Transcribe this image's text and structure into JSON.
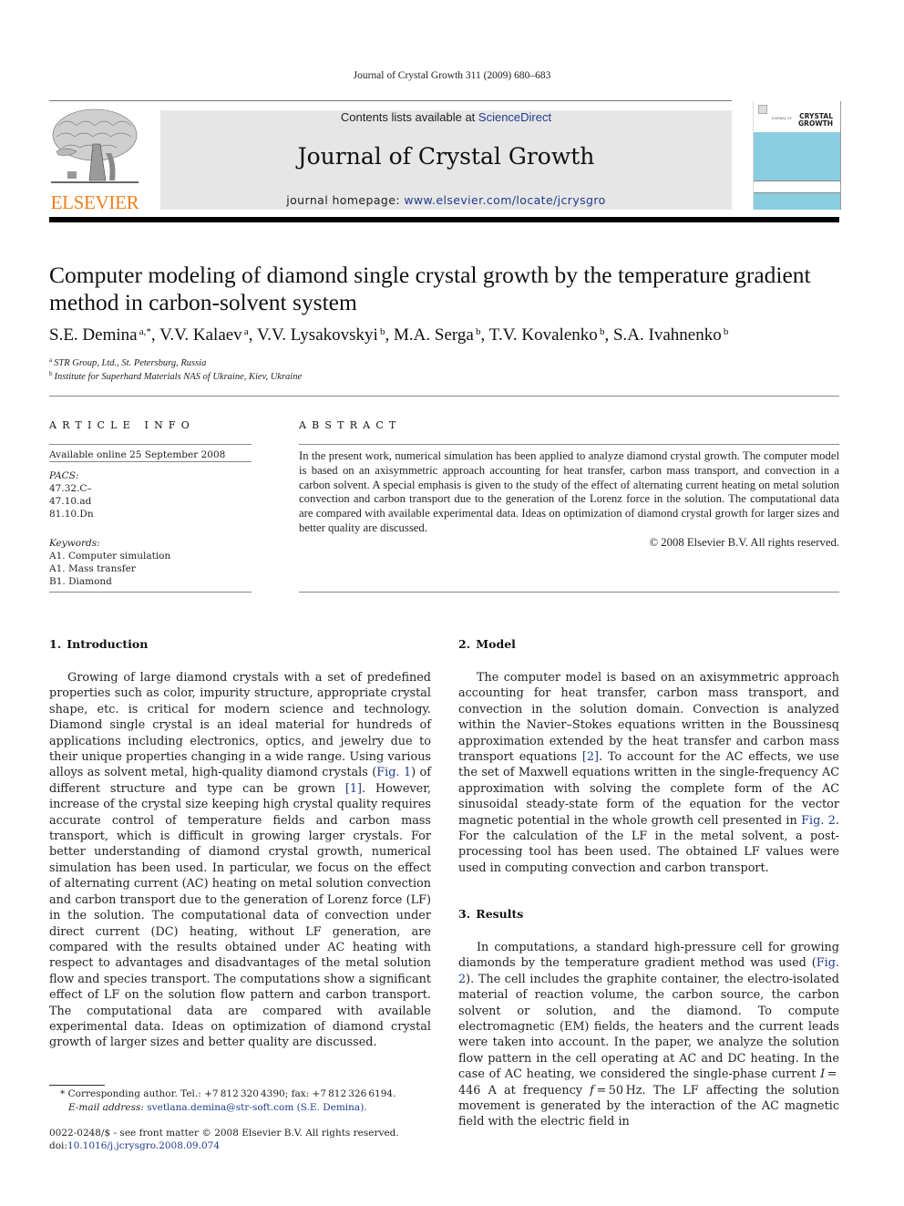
{
  "running_header": "Journal of Crystal Growth 311 (2009) 680–683",
  "banner": {
    "contents_prefix": "Contents lists available at ",
    "contents_link": "ScienceDirect",
    "journal_title": "Journal of Crystal Growth",
    "homepage_prefix": "journal homepage: ",
    "homepage_link": "www.elsevier.com/locate/jcrysgro"
  },
  "publisher_logo": {
    "wordmark": "ELSEVIER",
    "color": "#f07e1c"
  },
  "cover": {
    "small_text": "JOURNAL OF",
    "title_line1": "CRYSTAL",
    "title_line2": "GROWTH",
    "accent": "#8bcde0"
  },
  "article": {
    "title": "Computer modeling of diamond single crystal growth by the temperature gradient method in carbon-solvent system",
    "authors": [
      {
        "name": "S.E. Demina",
        "sup": "a,*"
      },
      {
        "name": "V.V. Kalaev",
        "sup": "a"
      },
      {
        "name": "V.V. Lysakovskyi",
        "sup": "b"
      },
      {
        "name": "M.A. Serga",
        "sup": "b"
      },
      {
        "name": "T.V. Kovalenko",
        "sup": "b"
      },
      {
        "name": "S.A. Ivahnenko",
        "sup": "b"
      }
    ],
    "affiliations": [
      {
        "sup": "a",
        "text": "STR Group, Ltd., St. Petersburg, Russia"
      },
      {
        "sup": "b",
        "text": "Institute for Superhard Materials NAS of Ukraine, Kiev, Ukraine"
      }
    ]
  },
  "article_info": {
    "heading": "ARTICLE INFO",
    "available_online": "Available online 25 September 2008",
    "pacs_label": "PACS:",
    "pacs": [
      "47.32.C–",
      "47.10.ad",
      "81.10.Dn"
    ],
    "keywords_label": "Keywords:",
    "keywords": [
      "A1. Computer simulation",
      "A1. Mass transfer",
      "B1. Diamond"
    ]
  },
  "abstract": {
    "heading": "ABSTRACT",
    "text": "In the present work, numerical simulation has been applied to analyze diamond crystal growth. The computer model is based on an axisymmetric approach accounting for heat transfer, carbon mass transport, and convection in a carbon solvent. A special emphasis is given to the study of the effect of alternating current heating on metal solution convection and carbon transport due to the generation of the Lorenz force in the solution. The computational data are compared with available experimental data. Ideas on optimization of diamond crystal growth for larger sizes and better quality are discussed.",
    "copyright": "© 2008 Elsevier B.V. All rights reserved."
  },
  "sections": {
    "intro": {
      "heading": "1. Introduction",
      "p_before_fig": "Growing of large diamond crystals with a set of predefined properties such as color, impurity structure, appropriate crystal shape, etc. is critical for modern science and technology. Diamond single crystal is an ideal material for hundreds of applications including electronics, optics, and jewelry due to their unique properties changing in a wide range. Using various alloys as solvent metal, high-quality diamond crystals (",
      "fig_ref": "Fig. 1",
      "p_between": ") of different structure and type can be grown ",
      "ref1": "[1]",
      "p_after": ". However, increase of the crystal size keeping high crystal quality requires accurate control of temperature fields and carbon mass transport, which is difficult in growing larger crystals. For better understanding of diamond crystal growth, numerical simulation has been used. In particular, we focus on the effect of alternating current (AC) heating on metal solution convection and carbon transport due to the generation of Lorenz force (LF) in the solution. The computational data of convection under direct current (DC) heating, without LF generation, are compared with the results obtained under AC heating with respect to advantages and disadvantages of the metal solution flow and species transport. The computations show a significant effect of LF on the solution flow pattern and carbon transport. The computational data are compared with available experimental data. Ideas on optimization of diamond crystal growth of larger sizes and better quality are discussed."
    },
    "model": {
      "heading": "2. Model",
      "p1": "The computer model is based on an axisymmetric approach accounting for heat transfer, carbon mass transport, and convection in the solution domain. Convection is analyzed within the Navier–Stokes equations written in the Boussinesq approximation extended by the heat transfer and carbon mass transport equations ",
      "ref2": "[2]",
      "p2": ". To account for the AC effects, we use the set of Maxwell equations written in the single-frequency AC approximation with solving the complete form of the AC sinusoidal steady-state form of the equation for the vector magnetic potential in the whole growth cell presented in ",
      "fig_ref": "Fig. 2",
      "p3": ". For the calculation of the LF in the metal solvent, a post-processing tool has been used. The obtained LF values were used in computing convection and carbon transport."
    },
    "results": {
      "heading": "3. Results",
      "p1": "In computations, a standard high-pressure cell for growing diamonds by the temperature gradient method was used (",
      "fig_ref": "Fig. 2",
      "p2": "). The cell includes the graphite container, the electro-isolated material of reaction volume, the carbon source, the carbon solvent or solution, and the diamond. To compute electromagnetic (EM) fields, the heaters and the current leads were taken into account. In the paper, we analyze the solution flow pattern in the cell operating at AC and DC heating. In the case of AC heating, we considered the single-phase current ",
      "var_I": "I",
      "p3": " = 446 A at frequency ",
      "var_f": "f",
      "p4": " = 50 Hz. The LF affecting the solution movement is generated by the interaction of the AC magnetic field with the electric field in"
    }
  },
  "footnotes": {
    "corresponding": "* Corresponding author. Tel.: +7 812 320 4390; fax: +7 812 326 6194.",
    "email_label": "E-mail address:",
    "email": "svetlana.demina@str-soft.com",
    "email_name": "(S.E. Demina).",
    "issn_line": "0022-0248/$ - see front matter © 2008 Elsevier B.V. All rights reserved.",
    "doi_label": "doi:",
    "doi": "10.1016/j.jcrysgro.2008.09.074"
  }
}
